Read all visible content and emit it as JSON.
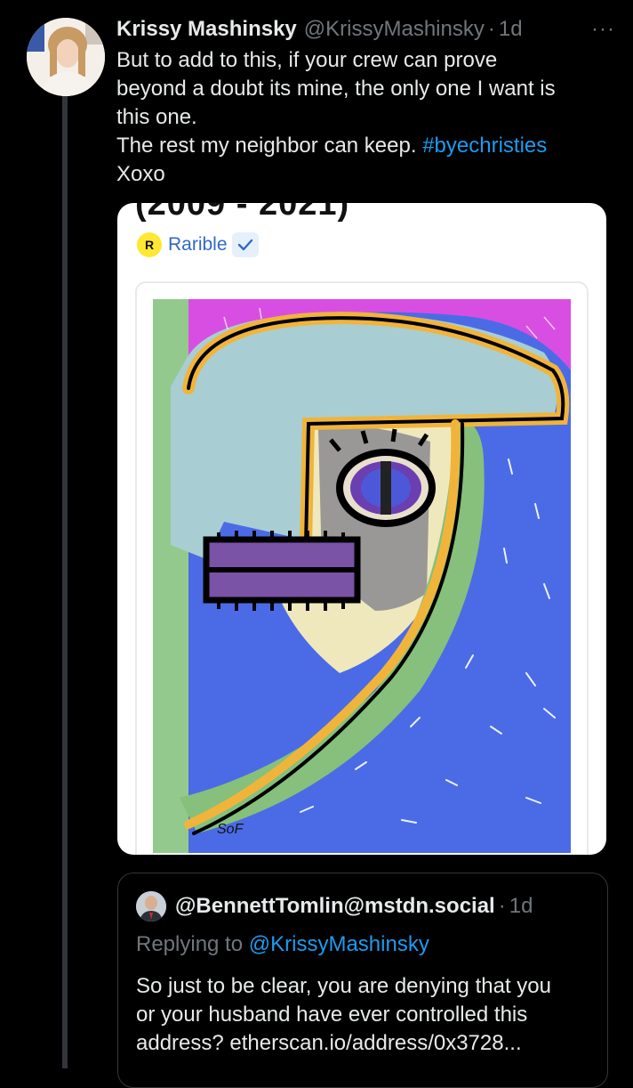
{
  "tweet": {
    "display_name": "Krissy Mashinsky",
    "handle": "@KrissyMashinsky",
    "separator": "·",
    "time": "1d",
    "more": "···",
    "text_lines": [
      "But to add to this, if your crew can prove",
      "beyond a doubt its mine, the only one I want is",
      "this one."
    ],
    "line4_text": "The rest my neighbor can keep. ",
    "hashtag": "#byechristies",
    "line5": "Xoxo"
  },
  "card": {
    "cut_title": "(2009 - 2021)",
    "source_logo_letter": "R",
    "source_name": "Rarible",
    "artwork_signature": "SoF"
  },
  "quote": {
    "author": "@BennettTomlin@mstdn.social",
    "separator": "·",
    "time": "1d",
    "replying_prefix": "Replying to ",
    "replying_handle": "@KrissyMashinsky",
    "text_lines": [
      "So just to be clear, you are denying that you",
      "or your husband have ever controlled this",
      "address? etherscan.io/address/0x3728..."
    ]
  },
  "colors": {
    "background": "#000000",
    "text_primary": "#e7e9ea",
    "text_secondary": "#71767b",
    "link": "#1d9bf0",
    "rarible_yellow": "#fee833",
    "rarible_blue": "#2f6ac6"
  },
  "icons": {
    "more": "more-horizontal-icon",
    "verified": "verified-check-icon",
    "source_logo": "rarible-logo-icon"
  }
}
